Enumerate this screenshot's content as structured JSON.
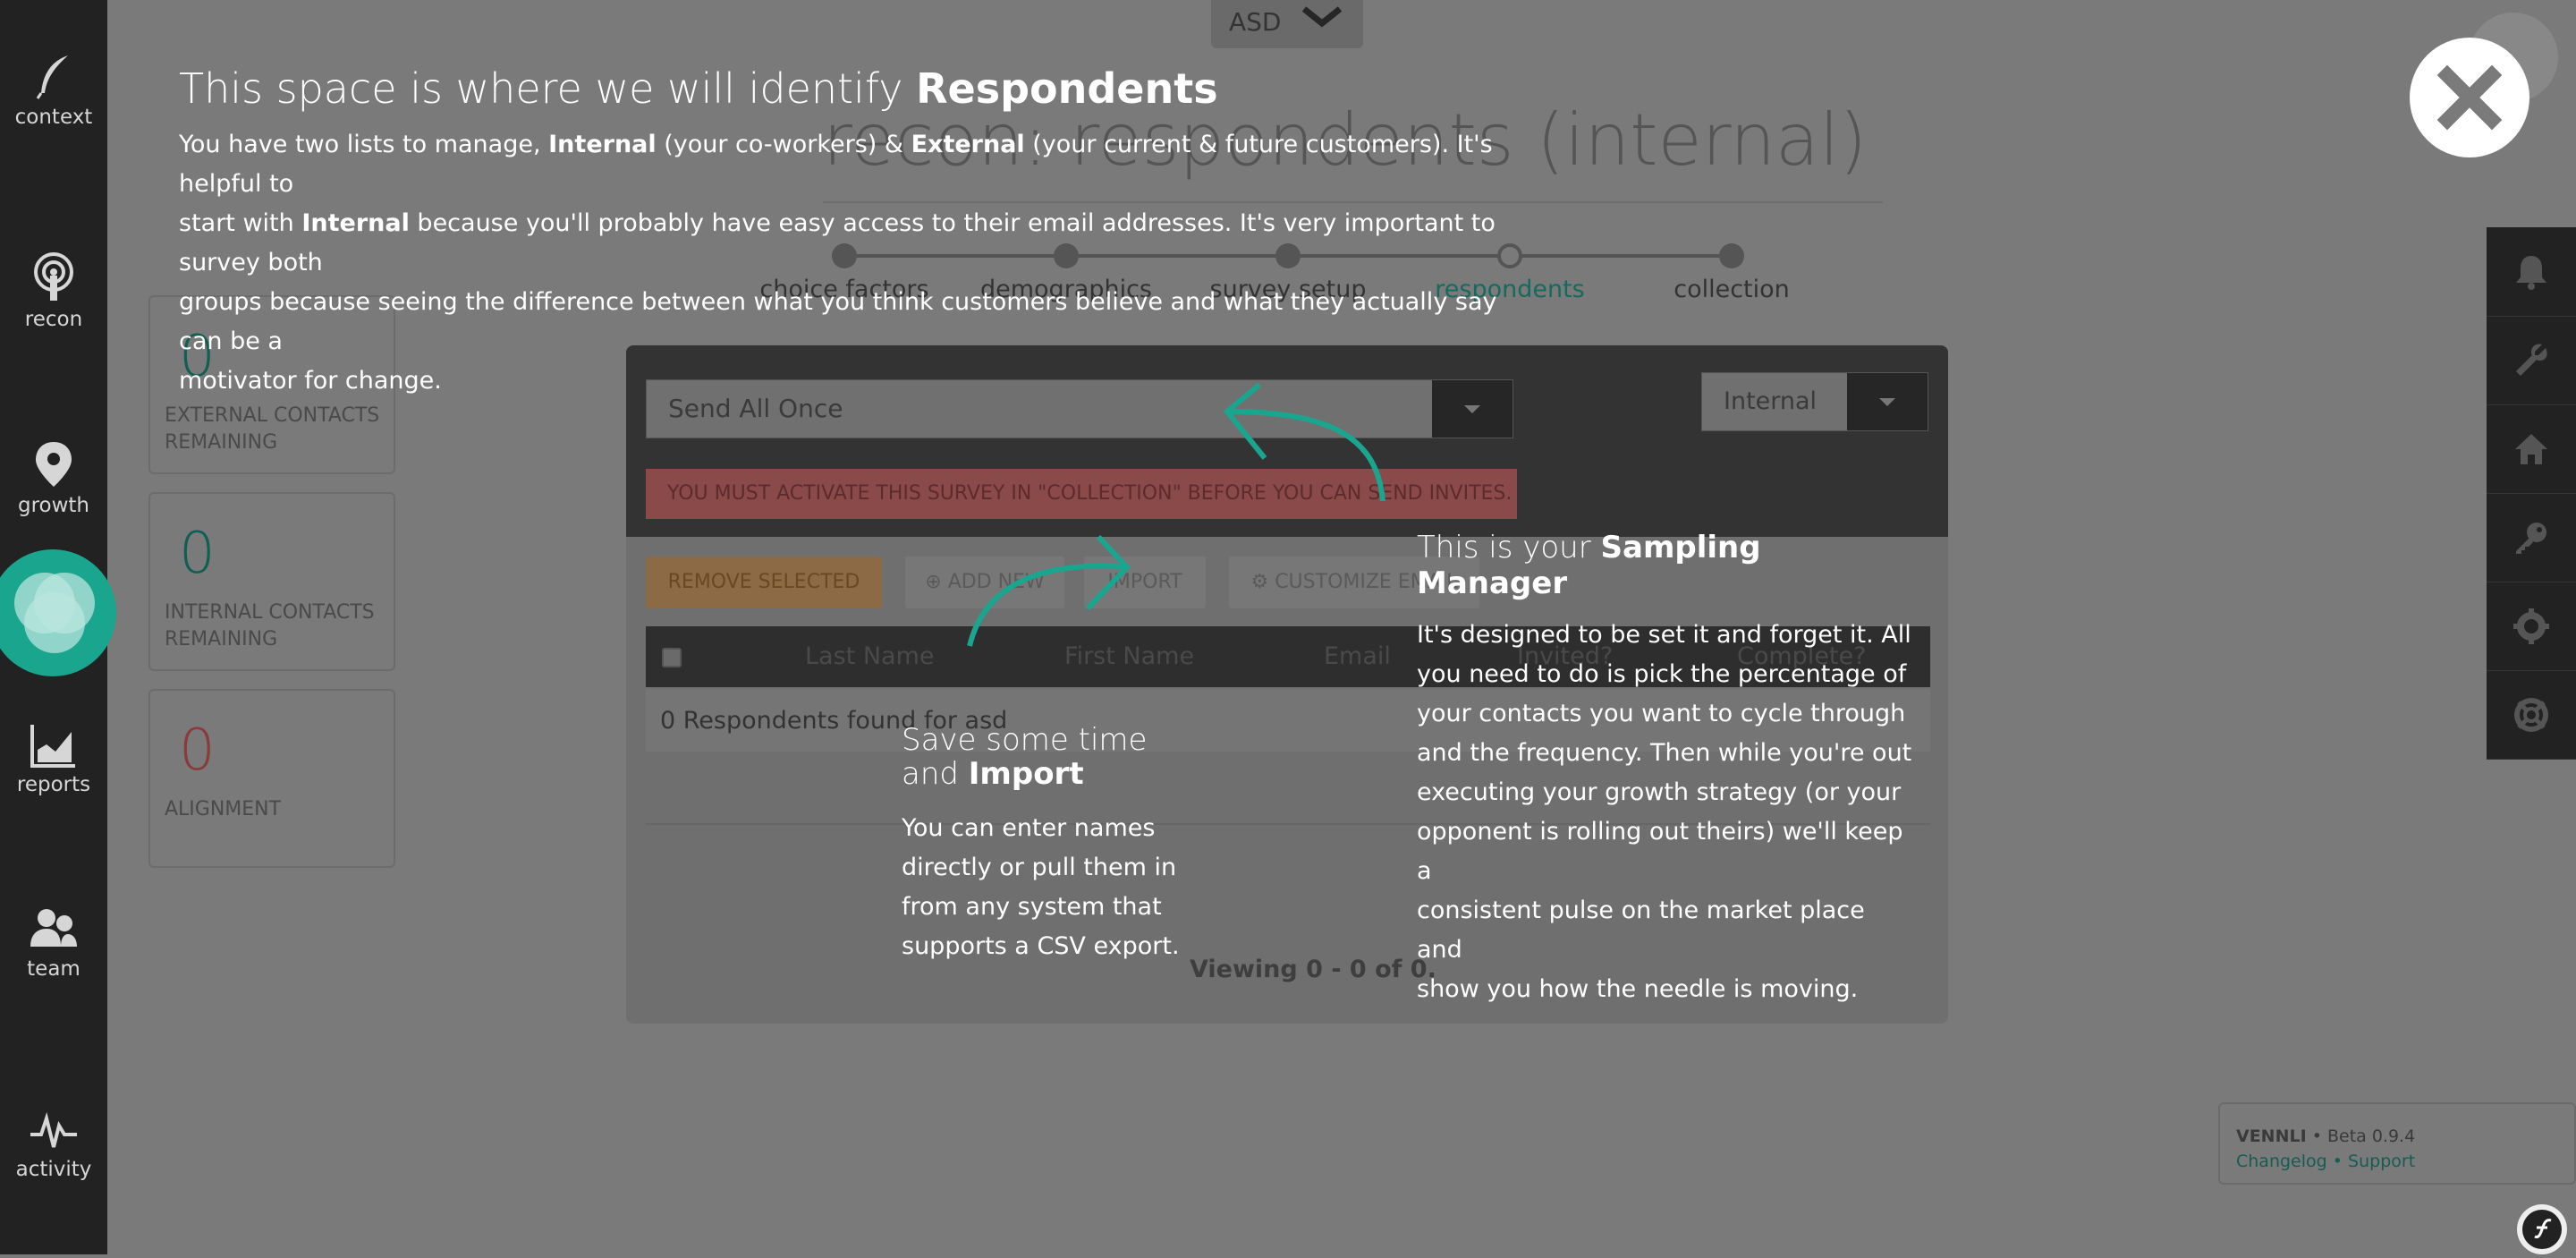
{
  "sidebar": {
    "items": [
      {
        "label": "context",
        "icon": "quill-icon"
      },
      {
        "label": "recon",
        "icon": "radar-icon"
      },
      {
        "label": "growth",
        "icon": "map-pin-icon"
      },
      {
        "label": "reports",
        "icon": "bar-chart-icon"
      },
      {
        "label": "team",
        "icon": "people-icon"
      },
      {
        "label": "activity",
        "icon": "pulse-icon"
      }
    ]
  },
  "header": {
    "org_select": "ASD",
    "page_title": "recon: respondents (internal)"
  },
  "stepper": {
    "steps": [
      "choice factors",
      "demographics",
      "survey setup",
      "respondents",
      "collection"
    ],
    "current": "respondents"
  },
  "stats": [
    {
      "value": "0",
      "label_line1": "External contacts",
      "label_line2": "remaining"
    },
    {
      "value": "0",
      "label_line1": "Internal contacts",
      "label_line2": "remaining"
    },
    {
      "value": "0",
      "label_line1": "Alignment",
      "label_line2": ""
    }
  ],
  "panel": {
    "send_mode": "Send All Once",
    "list_select": "Internal",
    "warning": "You must activate this survey in \"Collection\" before you can send invites.",
    "buttons": {
      "remove_selected": "Remove Selected",
      "add_new": "⊕ Add New",
      "import": "Import",
      "customize_email": "⚙ Customize Email"
    },
    "table": {
      "columns": [
        "Last Name",
        "First Name",
        "Email",
        "Invited?",
        "Complete?"
      ],
      "empty_message": "0 Respondents found for asd"
    },
    "pagination": "Viewing 0 - 0 of 0."
  },
  "footer": {
    "brand": "VENNLI",
    "version": "• Beta 0.9.4",
    "changelog": "Changelog",
    "sep": "•",
    "support": "Support"
  },
  "coach": {
    "main_title_prefix": "This space is where we will identify ",
    "main_title_bold": "Respondents",
    "main_text_1": "You have two lists to manage, ",
    "main_text_internal": "Internal",
    "main_text_2": " (your co-workers) & ",
    "main_text_external": "External",
    "main_text_3": " (your current & future customers). It's helpful to",
    "main_text_4": "start with ",
    "main_text_internal2": "Internal",
    "main_text_5": " because you'll probably have easy access to their email addresses. It's very important to survey both",
    "main_text_6": "groups because seeing the difference between what you think customers believe and what they actually say can be a",
    "main_text_7": "motivator for change.",
    "sampling_title_prefix": "This is your ",
    "sampling_title_bold": "Sampling Manager",
    "sampling_text": [
      "It's designed to be set it and forget it. All",
      "you need to do is pick the percentage of",
      "your contacts you want to cycle through",
      "and the frequency. Then while you're out",
      "executing your growth strategy (or your",
      "opponent is rolling out theirs) we'll keep a",
      "consistent pulse on the market place and",
      "show you how the needle is moving."
    ],
    "import_title_line1": "Save some time",
    "import_title_prefix": "and ",
    "import_title_bold": "Import",
    "import_text": [
      "You can enter names",
      "directly or pull them in",
      "from any system that",
      "supports a CSV export."
    ]
  },
  "colors": {
    "accent": "#1aa58f",
    "sidebar": "#222222",
    "overlay": "#7a7a7a"
  }
}
